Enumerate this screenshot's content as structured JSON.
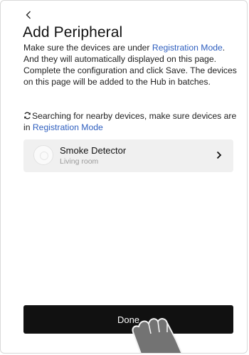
{
  "header": {
    "back_icon": "chevron-left-icon",
    "title": "Add Peripheral"
  },
  "description": {
    "part1": "Make sure the devices are under ",
    "link1": "Registration Mode",
    "part2": ". And they will automatically displayed on this page. Complete the configuration and click Save. The devices on this page will be added to the Hub in batches."
  },
  "searching": {
    "icon": "refresh-icon",
    "text": "Searching for nearby devices, make sure devices are in ",
    "link": "Registration Mode"
  },
  "devices": [
    {
      "name": "Smoke Detector",
      "room": "Living room",
      "icon": "smoke-detector-icon",
      "chevron": "chevron-right-icon"
    }
  ],
  "footer": {
    "done_label": "Done"
  },
  "colors": {
    "link": "#2f5fbf",
    "button_bg": "#111111",
    "card_bg": "#f0f0f0"
  }
}
